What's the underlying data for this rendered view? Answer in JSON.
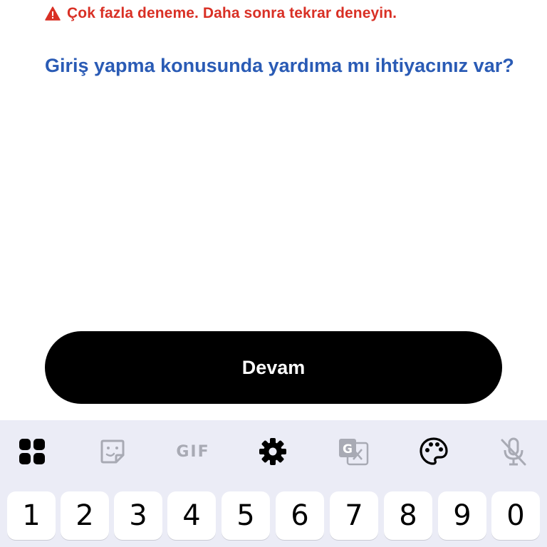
{
  "error": {
    "icon": "warning-icon",
    "message": "Çok fazla deneme. Daha sonra tekrar deneyin.",
    "color": "#d93025"
  },
  "help_link": {
    "text": "Giriş yapma konusunda yardıma mı ihtiyacınız var?",
    "color": "#2a5bb5"
  },
  "continue_button": {
    "label": "Devam"
  },
  "keyboard": {
    "toolbar": [
      {
        "name": "apps-grid-icon"
      },
      {
        "name": "sticker-icon"
      },
      {
        "name": "gif-button",
        "label": "GIF"
      },
      {
        "name": "settings-gear-icon"
      },
      {
        "name": "translate-icon"
      },
      {
        "name": "palette-icon"
      },
      {
        "name": "mic-off-icon"
      }
    ],
    "number_keys": [
      "1",
      "2",
      "3",
      "4",
      "5",
      "6",
      "7",
      "8",
      "9",
      "0"
    ]
  }
}
